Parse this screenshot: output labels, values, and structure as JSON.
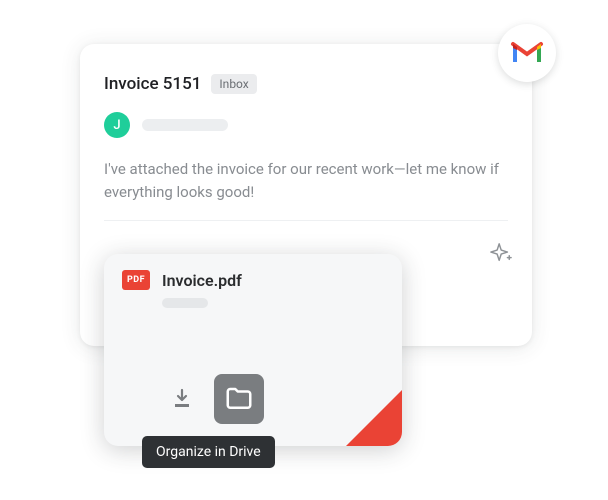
{
  "email": {
    "subject": "Invoice 5151",
    "label": "Inbox",
    "avatar_initial": "J",
    "body": "I've attached the invoice for our recent work—let me know if everything looks good!"
  },
  "attachment": {
    "badge": "PDF",
    "filename": "Invoice.pdf"
  },
  "tooltip": "Organize in Drive"
}
